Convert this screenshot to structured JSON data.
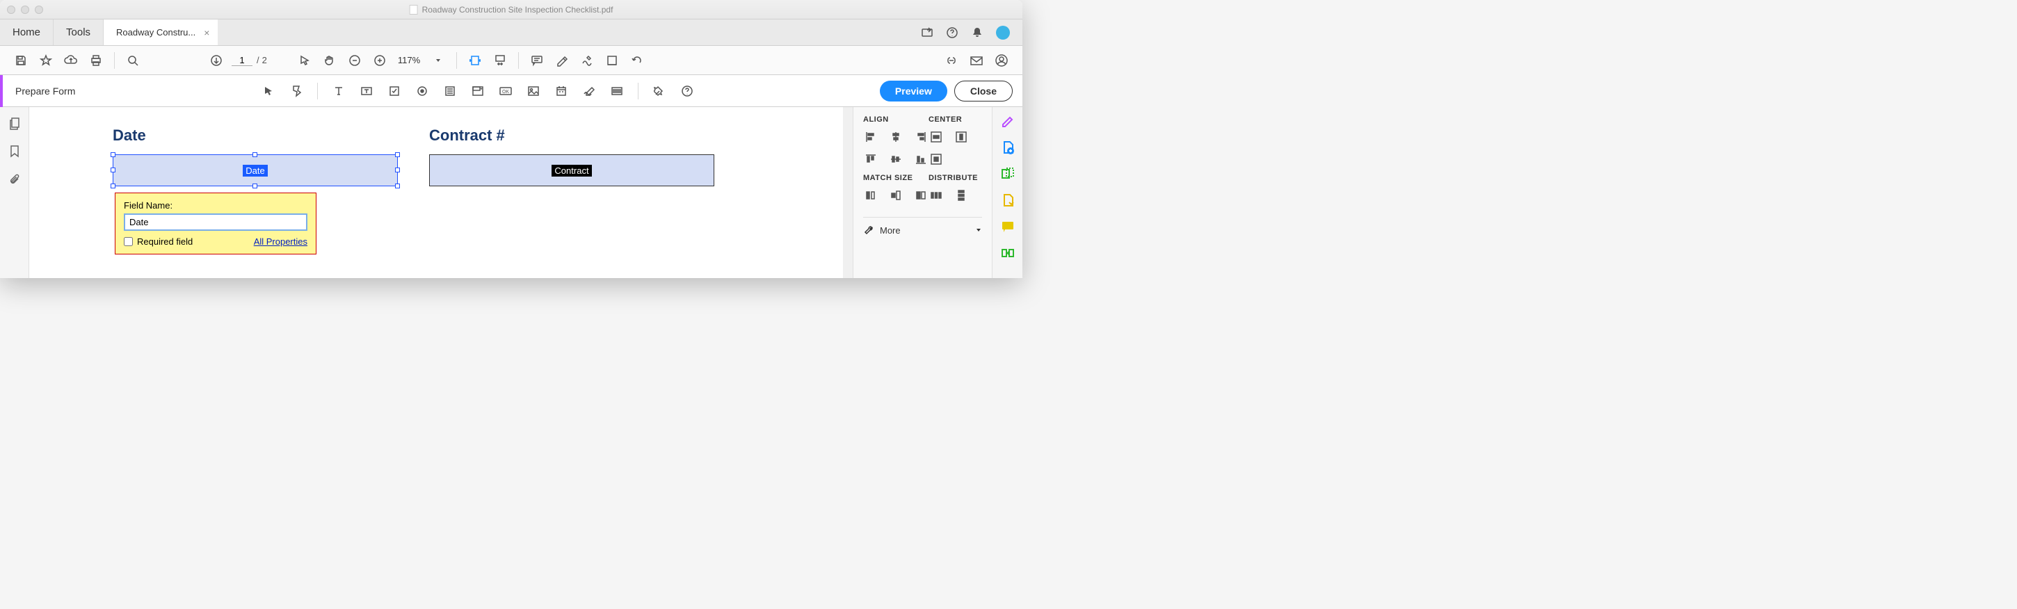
{
  "titlebar": {
    "title": "Roadway Construction Site Inspection Checklist.pdf"
  },
  "tabs": {
    "home": "Home",
    "tools": "Tools",
    "doc": "Roadway Constru..."
  },
  "toolbar": {
    "page_current": "1",
    "page_total": "2",
    "page_sep": "/",
    "zoom": "117%"
  },
  "form_toolbar": {
    "title": "Prepare Form",
    "preview": "Preview",
    "close": "Close"
  },
  "canvas": {
    "date_label": "Date",
    "date_field_name": "Date",
    "contract_label": "Contract #",
    "contract_field_name": "Contract"
  },
  "popup": {
    "label": "Field Name:",
    "value": "Date",
    "required": "Required field",
    "link": "All Properties"
  },
  "panel": {
    "align": "ALIGN",
    "center": "CENTER",
    "match": "MATCH SIZE",
    "distribute": "DISTRIBUTE",
    "more": "More"
  }
}
